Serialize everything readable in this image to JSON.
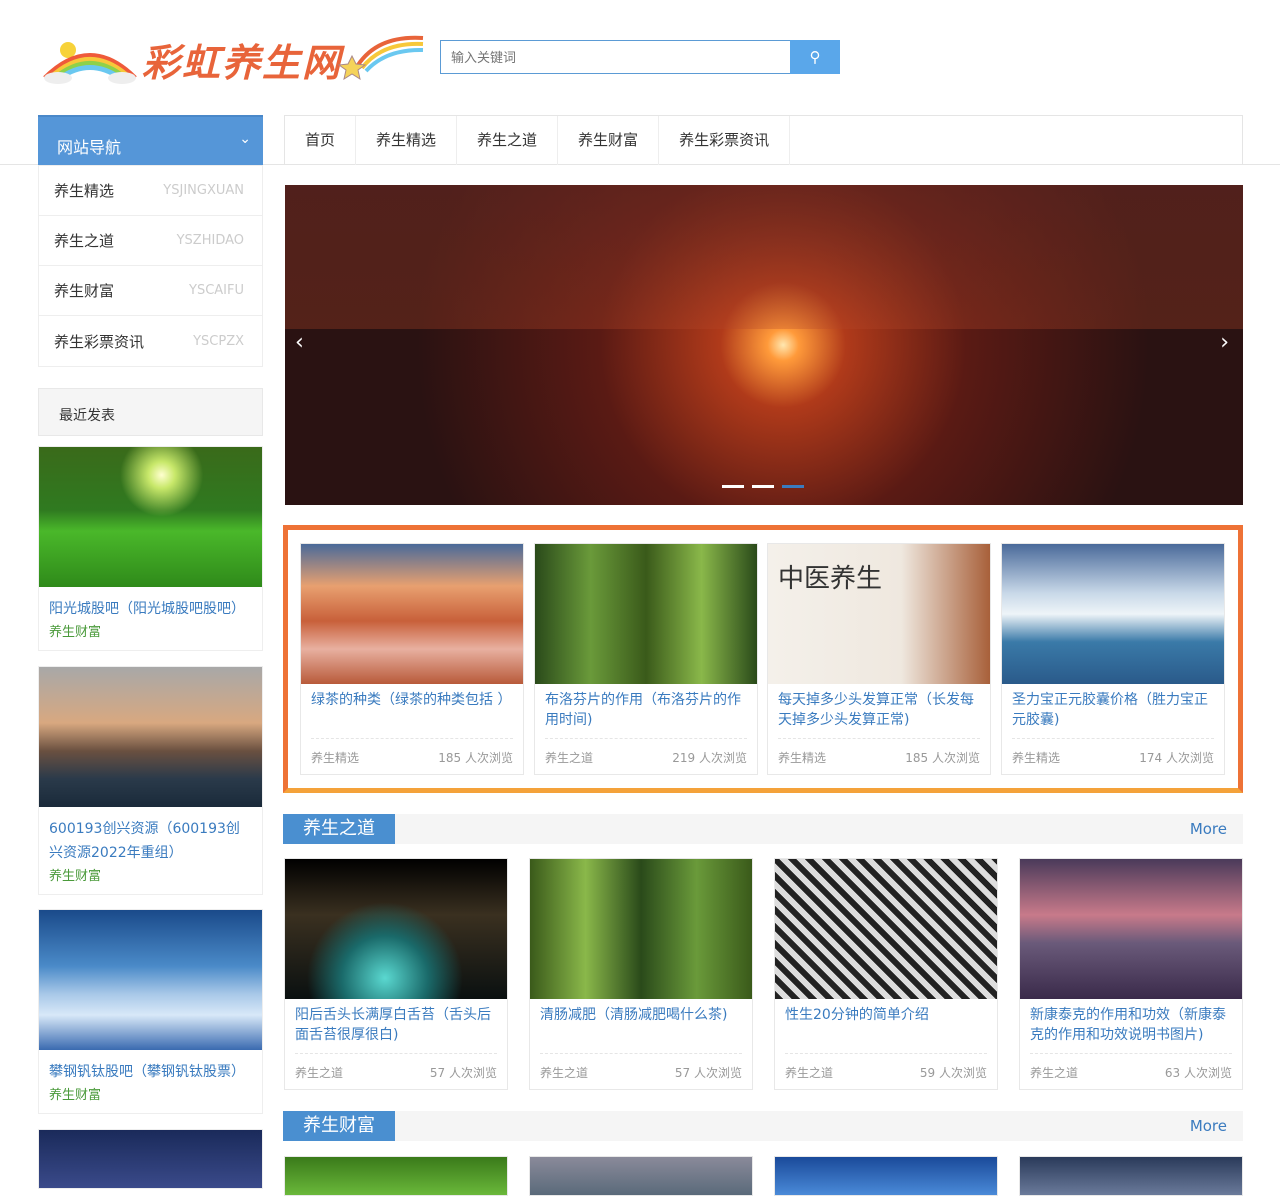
{
  "header": {
    "logo_text": "彩虹养生网",
    "search_placeholder": "输入关键词",
    "search_icon": "search-icon"
  },
  "nav": {
    "title": "网站导航",
    "items": [
      "首页",
      "养生精选",
      "养生之道",
      "养生财富",
      "养生彩票资讯"
    ]
  },
  "sidenav": [
    {
      "cn": "养生精选",
      "en": "YSJINGXUAN"
    },
    {
      "cn": "养生之道",
      "en": "YSZHIDAO"
    },
    {
      "cn": "养生财富",
      "en": "YSCAIFU"
    },
    {
      "cn": "养生彩票资讯",
      "en": "YSCPZX"
    }
  ],
  "recent": {
    "title": "最近发表",
    "items": [
      {
        "title": "阳光城股吧（阳光城股吧股吧）",
        "cat": "养生财富"
      },
      {
        "title": "600193创兴资源（600193创兴资源2022年重组）",
        "cat": "养生财富"
      },
      {
        "title": "攀钢钒钛股吧（攀钢钒钛股票）",
        "cat": "养生财富"
      }
    ]
  },
  "featured": [
    {
      "title": "绿茶的种类（绿茶的种类包括 ）",
      "cat": "养生精选",
      "views": "185 人次浏览"
    },
    {
      "title": "布洛芬片的作用（布洛芬片的作用时间)",
      "cat": "养生之道",
      "views": "219 人次浏览"
    },
    {
      "title": "每天掉多少头发算正常（长发每天掉多少头发算正常)",
      "cat": "养生精选",
      "views": "185 人次浏览",
      "img_text": "中医养生"
    },
    {
      "title": "圣力宝正元胶囊价格（胜力宝正元胶囊)",
      "cat": "养生精选",
      "views": "174 人次浏览"
    }
  ],
  "sections": [
    {
      "label": "养生之道",
      "more": "More",
      "items": [
        {
          "title": "阳后舌头长满厚白舌苔（舌头后面舌苔很厚很白)",
          "cat": "养生之道",
          "views": "57 人次浏览"
        },
        {
          "title": "清肠减肥（清肠减肥喝什么茶)",
          "cat": "养生之道",
          "views": "57 人次浏览"
        },
        {
          "title": "性生20分钟的简单介绍",
          "cat": "养生之道",
          "views": "59 人次浏览"
        },
        {
          "title": "新康泰克的作用和功效（新康泰克的作用和功效说明书图片)",
          "cat": "养生之道",
          "views": "63 人次浏览"
        }
      ]
    },
    {
      "label": "养生财富",
      "more": "More"
    }
  ]
}
